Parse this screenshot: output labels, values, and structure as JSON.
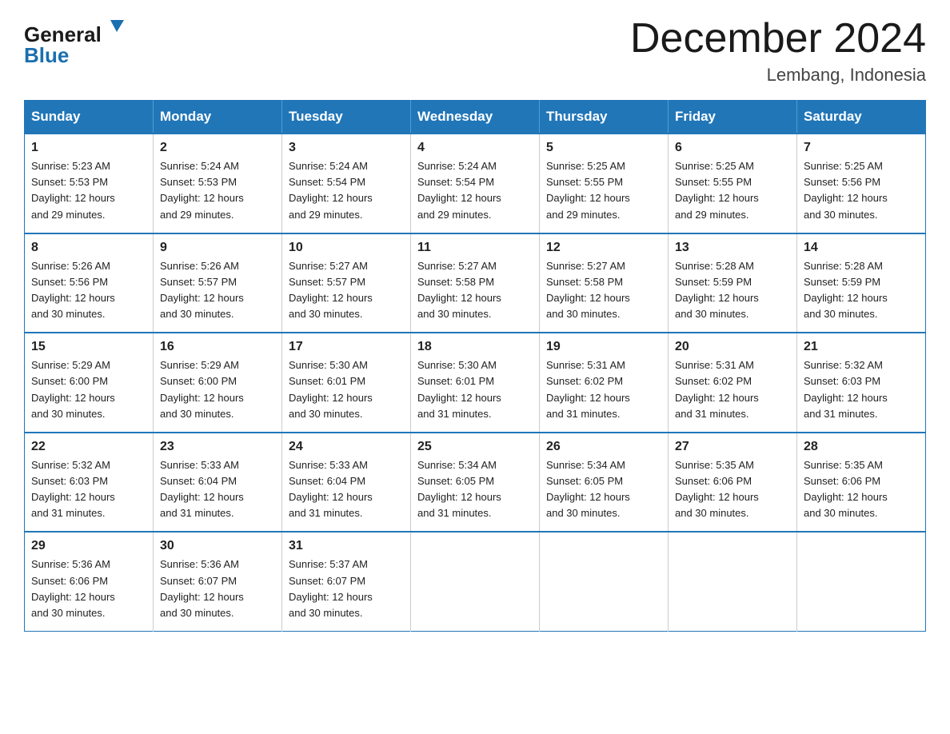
{
  "header": {
    "logo_general": "General",
    "logo_blue": "Blue",
    "month_title": "December 2024",
    "location": "Lembang, Indonesia"
  },
  "days_of_week": [
    "Sunday",
    "Monday",
    "Tuesday",
    "Wednesday",
    "Thursday",
    "Friday",
    "Saturday"
  ],
  "weeks": [
    [
      {
        "day": "1",
        "sunrise": "5:23 AM",
        "sunset": "5:53 PM",
        "daylight": "12 hours and 29 minutes."
      },
      {
        "day": "2",
        "sunrise": "5:24 AM",
        "sunset": "5:53 PM",
        "daylight": "12 hours and 29 minutes."
      },
      {
        "day": "3",
        "sunrise": "5:24 AM",
        "sunset": "5:54 PM",
        "daylight": "12 hours and 29 minutes."
      },
      {
        "day": "4",
        "sunrise": "5:24 AM",
        "sunset": "5:54 PM",
        "daylight": "12 hours and 29 minutes."
      },
      {
        "day": "5",
        "sunrise": "5:25 AM",
        "sunset": "5:55 PM",
        "daylight": "12 hours and 29 minutes."
      },
      {
        "day": "6",
        "sunrise": "5:25 AM",
        "sunset": "5:55 PM",
        "daylight": "12 hours and 29 minutes."
      },
      {
        "day": "7",
        "sunrise": "5:25 AM",
        "sunset": "5:56 PM",
        "daylight": "12 hours and 30 minutes."
      }
    ],
    [
      {
        "day": "8",
        "sunrise": "5:26 AM",
        "sunset": "5:56 PM",
        "daylight": "12 hours and 30 minutes."
      },
      {
        "day": "9",
        "sunrise": "5:26 AM",
        "sunset": "5:57 PM",
        "daylight": "12 hours and 30 minutes."
      },
      {
        "day": "10",
        "sunrise": "5:27 AM",
        "sunset": "5:57 PM",
        "daylight": "12 hours and 30 minutes."
      },
      {
        "day": "11",
        "sunrise": "5:27 AM",
        "sunset": "5:58 PM",
        "daylight": "12 hours and 30 minutes."
      },
      {
        "day": "12",
        "sunrise": "5:27 AM",
        "sunset": "5:58 PM",
        "daylight": "12 hours and 30 minutes."
      },
      {
        "day": "13",
        "sunrise": "5:28 AM",
        "sunset": "5:59 PM",
        "daylight": "12 hours and 30 minutes."
      },
      {
        "day": "14",
        "sunrise": "5:28 AM",
        "sunset": "5:59 PM",
        "daylight": "12 hours and 30 minutes."
      }
    ],
    [
      {
        "day": "15",
        "sunrise": "5:29 AM",
        "sunset": "6:00 PM",
        "daylight": "12 hours and 30 minutes."
      },
      {
        "day": "16",
        "sunrise": "5:29 AM",
        "sunset": "6:00 PM",
        "daylight": "12 hours and 30 minutes."
      },
      {
        "day": "17",
        "sunrise": "5:30 AM",
        "sunset": "6:01 PM",
        "daylight": "12 hours and 30 minutes."
      },
      {
        "day": "18",
        "sunrise": "5:30 AM",
        "sunset": "6:01 PM",
        "daylight": "12 hours and 31 minutes."
      },
      {
        "day": "19",
        "sunrise": "5:31 AM",
        "sunset": "6:02 PM",
        "daylight": "12 hours and 31 minutes."
      },
      {
        "day": "20",
        "sunrise": "5:31 AM",
        "sunset": "6:02 PM",
        "daylight": "12 hours and 31 minutes."
      },
      {
        "day": "21",
        "sunrise": "5:32 AM",
        "sunset": "6:03 PM",
        "daylight": "12 hours and 31 minutes."
      }
    ],
    [
      {
        "day": "22",
        "sunrise": "5:32 AM",
        "sunset": "6:03 PM",
        "daylight": "12 hours and 31 minutes."
      },
      {
        "day": "23",
        "sunrise": "5:33 AM",
        "sunset": "6:04 PM",
        "daylight": "12 hours and 31 minutes."
      },
      {
        "day": "24",
        "sunrise": "5:33 AM",
        "sunset": "6:04 PM",
        "daylight": "12 hours and 31 minutes."
      },
      {
        "day": "25",
        "sunrise": "5:34 AM",
        "sunset": "6:05 PM",
        "daylight": "12 hours and 31 minutes."
      },
      {
        "day": "26",
        "sunrise": "5:34 AM",
        "sunset": "6:05 PM",
        "daylight": "12 hours and 30 minutes."
      },
      {
        "day": "27",
        "sunrise": "5:35 AM",
        "sunset": "6:06 PM",
        "daylight": "12 hours and 30 minutes."
      },
      {
        "day": "28",
        "sunrise": "5:35 AM",
        "sunset": "6:06 PM",
        "daylight": "12 hours and 30 minutes."
      }
    ],
    [
      {
        "day": "29",
        "sunrise": "5:36 AM",
        "sunset": "6:06 PM",
        "daylight": "12 hours and 30 minutes."
      },
      {
        "day": "30",
        "sunrise": "5:36 AM",
        "sunset": "6:07 PM",
        "daylight": "12 hours and 30 minutes."
      },
      {
        "day": "31",
        "sunrise": "5:37 AM",
        "sunset": "6:07 PM",
        "daylight": "12 hours and 30 minutes."
      },
      null,
      null,
      null,
      null
    ]
  ],
  "labels": {
    "sunrise": "Sunrise:",
    "sunset": "Sunset:",
    "daylight": "Daylight:"
  }
}
